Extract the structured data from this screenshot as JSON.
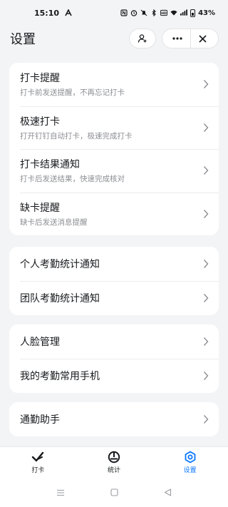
{
  "status_bar": {
    "time": "15:10",
    "battery": "43%"
  },
  "header": {
    "title": "设置"
  },
  "groups": [
    {
      "items": [
        {
          "title": "打卡提醒",
          "subtitle": "打卡前发送提醒，不再忘记打卡"
        },
        {
          "title": "极速打卡",
          "subtitle": "打开钉钉自动打卡，极速完成打卡"
        },
        {
          "title": "打卡结果通知",
          "subtitle": "打卡后发送结果，快速完成核对"
        },
        {
          "title": "缺卡提醒",
          "subtitle": "缺卡后发送消息提醒"
        }
      ]
    },
    {
      "items": [
        {
          "title": "个人考勤统计通知"
        },
        {
          "title": "团队考勤统计通知"
        }
      ]
    },
    {
      "items": [
        {
          "title": "人脸管理"
        },
        {
          "title": "我的考勤常用手机"
        }
      ]
    },
    {
      "items": [
        {
          "title": "通勤助手"
        }
      ]
    }
  ],
  "tabbar": {
    "tabs": [
      {
        "label": "打卡",
        "icon": "check-icon",
        "active": false
      },
      {
        "label": "统计",
        "icon": "stats-icon",
        "active": false
      },
      {
        "label": "设置",
        "icon": "gear-icon",
        "active": true
      }
    ]
  },
  "colors": {
    "background": "#f3f4f6",
    "accent": "#0a77ff",
    "text_primary": "#171a1d",
    "text_secondary": "#8c8e93"
  }
}
